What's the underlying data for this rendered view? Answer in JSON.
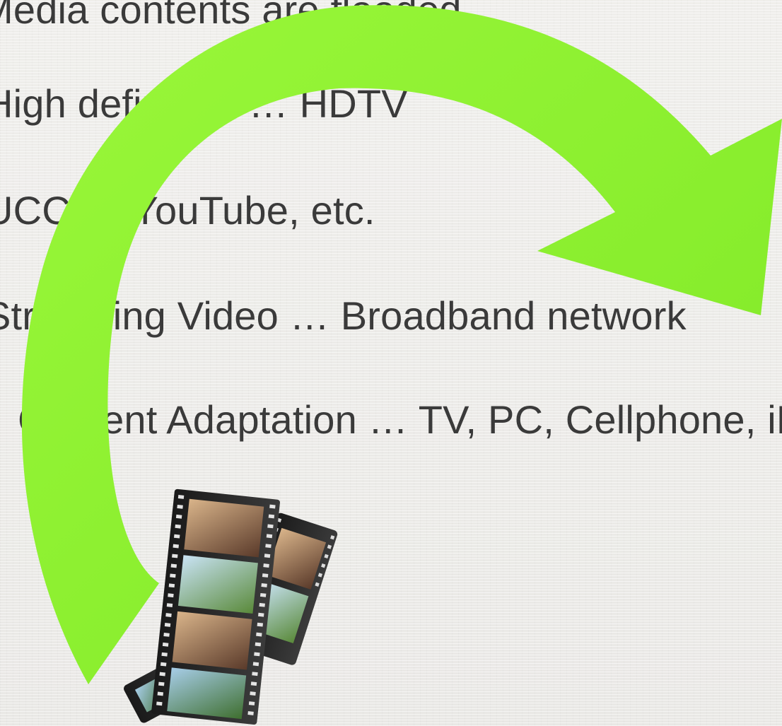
{
  "slide": {
    "bullets": [
      "Media contents are flooded",
      "High definition … HDTV",
      "UCC … YouTube, etc.",
      "Streaming Video … Broadband network",
      "Content Adaptation … TV, PC, Cellphone, iPod"
    ],
    "arrow": {
      "name": "curved-arrow",
      "color": "#8ef230",
      "shadow_color": "#6ad11e"
    },
    "image": {
      "name": "film-strip"
    }
  }
}
